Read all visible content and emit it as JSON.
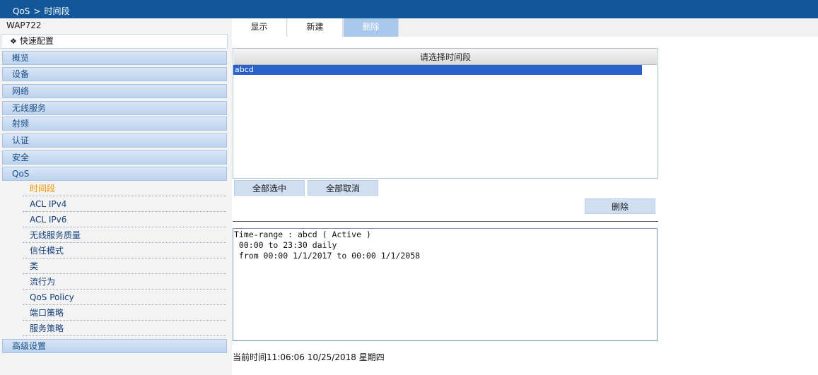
{
  "breadcrumb": {
    "section": "QoS",
    "separator": ">",
    "page": "时间段"
  },
  "sidebar": {
    "device": "WAP722",
    "quick_config": "快速配置",
    "menu": [
      {
        "label": "概览"
      },
      {
        "label": "设备"
      },
      {
        "label": "网络"
      },
      {
        "label": "无线服务"
      },
      {
        "label": "射频"
      },
      {
        "label": "认证"
      },
      {
        "label": "安全"
      },
      {
        "label": "QoS"
      }
    ],
    "qos_items": [
      {
        "label": "时间段",
        "active": true
      },
      {
        "label": "ACL IPv4"
      },
      {
        "label": "ACL IPv6"
      },
      {
        "label": "无线服务质量"
      },
      {
        "label": "信任模式"
      },
      {
        "label": "类"
      },
      {
        "label": "流行为"
      },
      {
        "label": "QoS Policy"
      },
      {
        "label": "端口策略"
      },
      {
        "label": "服务策略"
      }
    ],
    "advanced": "高级设置"
  },
  "tabs": [
    {
      "label": "显示"
    },
    {
      "label": "新建"
    },
    {
      "label": "删除",
      "selected": true
    }
  ],
  "list": {
    "header": "请选择时间段",
    "items": [
      "abcd"
    ],
    "selected": "abcd"
  },
  "buttons": {
    "select_all": "全部选中",
    "deselect_all": "全部取消",
    "delete": "删除"
  },
  "detail_text": "Time-range : abcd ( Active )\n 00:00 to 23:30 daily\n from 00:00 1/1/2017 to 00:00 1/1/2058",
  "clock": "当前时间11:06:06 10/25/2018 星期四",
  "colors": {
    "topbar": "#12579a",
    "active_item": "#f19300",
    "selected_row": "#2a62c9",
    "selected_tab": "#a9c8ec"
  }
}
